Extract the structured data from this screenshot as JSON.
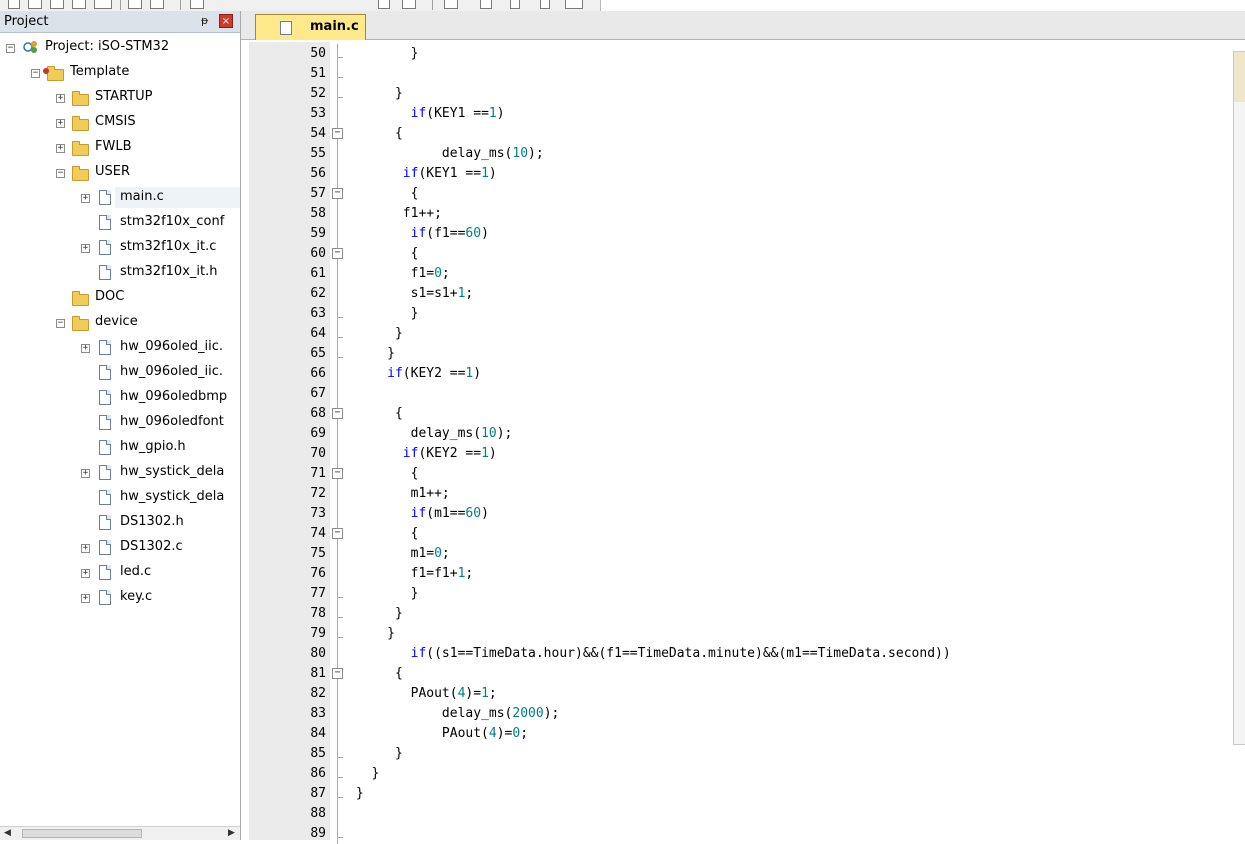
{
  "project_panel": {
    "title": "Project",
    "pin_glyph": "ᵽ",
    "close_glyph": "×",
    "tree": [
      {
        "label": "Project: iSO-STM32",
        "icon": "project-icon",
        "level": 0,
        "expander": "minus"
      },
      {
        "label": "Template",
        "icon": "target-folder-icon",
        "level": 1,
        "expander": "minus"
      },
      {
        "label": "STARTUP",
        "icon": "folder-icon",
        "level": 2,
        "expander": "plus"
      },
      {
        "label": "CMSIS",
        "icon": "folder-icon",
        "level": 2,
        "expander": "plus"
      },
      {
        "label": "FWLB",
        "icon": "folder-icon",
        "level": 2,
        "expander": "plus"
      },
      {
        "label": "USER",
        "icon": "folder-open-icon",
        "level": 2,
        "expander": "minus"
      },
      {
        "label": "main.c",
        "icon": "file-icon",
        "level": 3,
        "expander": "plus",
        "selected": true
      },
      {
        "label": "stm32f10x_conf",
        "icon": "file-icon",
        "level": 3,
        "expander": "none"
      },
      {
        "label": "stm32f10x_it.c",
        "icon": "file-icon",
        "level": 3,
        "expander": "plus"
      },
      {
        "label": "stm32f10x_it.h",
        "icon": "file-icon",
        "level": 3,
        "expander": "none"
      },
      {
        "label": "DOC",
        "icon": "folder-open-icon",
        "level": 2,
        "expander": "none"
      },
      {
        "label": "device",
        "icon": "folder-open-icon",
        "level": 2,
        "expander": "minus"
      },
      {
        "label": "hw_096oled_iic.",
        "icon": "file-icon",
        "level": 3,
        "expander": "plus"
      },
      {
        "label": "hw_096oled_iic.",
        "icon": "file-icon",
        "level": 3,
        "expander": "none"
      },
      {
        "label": "hw_096oledbmp",
        "icon": "file-icon",
        "level": 3,
        "expander": "none"
      },
      {
        "label": "hw_096oledfont",
        "icon": "file-icon",
        "level": 3,
        "expander": "none"
      },
      {
        "label": "hw_gpio.h",
        "icon": "file-icon",
        "level": 3,
        "expander": "none"
      },
      {
        "label": "hw_systick_dela",
        "icon": "file-icon",
        "level": 3,
        "expander": "plus"
      },
      {
        "label": "hw_systick_dela",
        "icon": "file-icon",
        "level": 3,
        "expander": "none"
      },
      {
        "label": "DS1302.h",
        "icon": "file-icon",
        "level": 3,
        "expander": "none"
      },
      {
        "label": "DS1302.c",
        "icon": "file-icon",
        "level": 3,
        "expander": "plus"
      },
      {
        "label": "led.c",
        "icon": "file-icon",
        "level": 3,
        "expander": "plus"
      },
      {
        "label": "key.c",
        "icon": "file-icon",
        "level": 3,
        "expander": "plus"
      }
    ]
  },
  "editor": {
    "active_tab": "main.c",
    "lines": [
      {
        "n": "50",
        "text": "        }",
        "fold": "tick"
      },
      {
        "n": "51",
        "text": "",
        "fold": "tick"
      },
      {
        "n": "52",
        "text": "      }",
        "fold": "tick"
      },
      {
        "n": "53",
        "text": "        if(KEY1 ==1)",
        "fold": "line"
      },
      {
        "n": "54",
        "text": "      {",
        "fold": "box"
      },
      {
        "n": "55",
        "text": "            delay_ms(10);",
        "fold": "line"
      },
      {
        "n": "56",
        "text": "       if(KEY1 ==1)",
        "fold": "line"
      },
      {
        "n": "57",
        "text": "        {",
        "fold": "box"
      },
      {
        "n": "58",
        "text": "       f1++;",
        "fold": "line"
      },
      {
        "n": "59",
        "text": "        if(f1==60)",
        "fold": "line"
      },
      {
        "n": "60",
        "text": "        {",
        "fold": "box"
      },
      {
        "n": "61",
        "text": "        f1=0;",
        "fold": "line"
      },
      {
        "n": "62",
        "text": "        s1=s1+1;",
        "fold": "line"
      },
      {
        "n": "63",
        "text": "        }",
        "fold": "tick"
      },
      {
        "n": "64",
        "text": "      }",
        "fold": "tick"
      },
      {
        "n": "65",
        "text": "     }",
        "fold": "tick"
      },
      {
        "n": "66",
        "text": "     if(KEY2 ==1)",
        "fold": "line"
      },
      {
        "n": "67",
        "text": "",
        "fold": "line"
      },
      {
        "n": "68",
        "text": "      {",
        "fold": "box"
      },
      {
        "n": "69",
        "text": "        delay_ms(10);",
        "fold": "line"
      },
      {
        "n": "70",
        "text": "       if(KEY2 ==1)",
        "fold": "line"
      },
      {
        "n": "71",
        "text": "        {",
        "fold": "box"
      },
      {
        "n": "72",
        "text": "        m1++;",
        "fold": "line"
      },
      {
        "n": "73",
        "text": "        if(m1==60)",
        "fold": "line"
      },
      {
        "n": "74",
        "text": "        {",
        "fold": "box"
      },
      {
        "n": "75",
        "text": "        m1=0;",
        "fold": "line"
      },
      {
        "n": "76",
        "text": "        f1=f1+1;",
        "fold": "line"
      },
      {
        "n": "77",
        "text": "        }",
        "fold": "tick"
      },
      {
        "n": "78",
        "text": "      }",
        "fold": "tick"
      },
      {
        "n": "79",
        "text": "     }",
        "fold": "tick"
      },
      {
        "n": "80",
        "text": "        if((s1==TimeData.hour)&&(f1==TimeData.minute)&&(m1==TimeData.second))",
        "fold": "line"
      },
      {
        "n": "81",
        "text": "      {",
        "fold": "box"
      },
      {
        "n": "82",
        "text": "        PAout(4)=1;",
        "fold": "line"
      },
      {
        "n": "83",
        "text": "            delay_ms(2000);",
        "fold": "line"
      },
      {
        "n": "84",
        "text": "            PAout(4)=0;",
        "fold": "line"
      },
      {
        "n": "85",
        "text": "      }",
        "fold": "tick"
      },
      {
        "n": "86",
        "text": "   }",
        "fold": "tick"
      },
      {
        "n": "87",
        "text": " }",
        "fold": "tick"
      },
      {
        "n": "88",
        "text": "",
        "fold": "line"
      },
      {
        "n": "89",
        "text": "",
        "fold": "tick"
      }
    ]
  },
  "colors": {
    "keyword": "#0000ff",
    "number": "#008080",
    "tab_active": "#ffe98a"
  }
}
